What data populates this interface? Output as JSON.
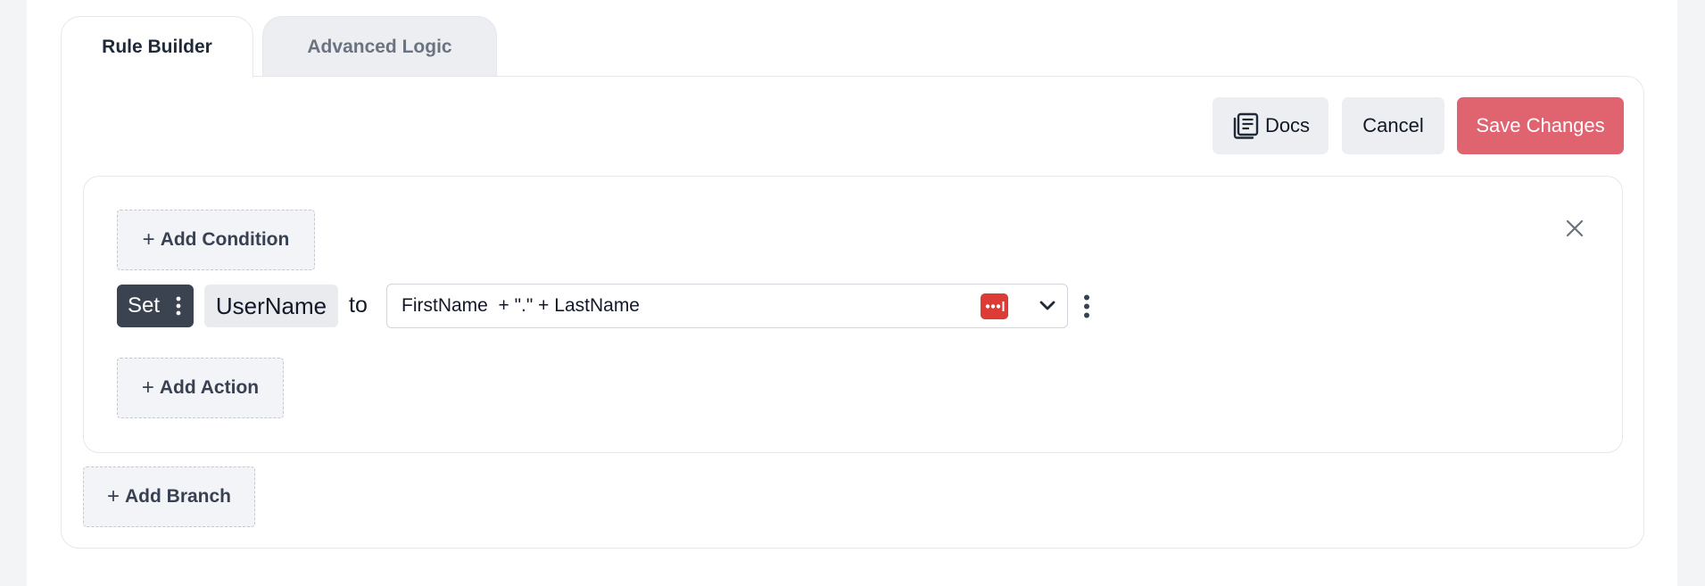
{
  "tabs": {
    "rule_builder": "Rule Builder",
    "advanced_logic": "Advanced Logic"
  },
  "toolbar": {
    "docs_label": "Docs",
    "cancel_label": "Cancel",
    "save_label": "Save Changes"
  },
  "rule": {
    "add_condition_label": "Add Condition",
    "add_action_label": "Add Action",
    "action": {
      "verb": "Set",
      "field": "UserName",
      "connector": "to",
      "expression": "FirstName  + \".\" + LastName"
    }
  },
  "add_branch_label": "Add Branch",
  "colors": {
    "save_button": "#e06370",
    "set_chip": "#3b4250",
    "expression_badge": "#dc3b36"
  },
  "icons": {
    "docs": "docs-icon",
    "plus": "plus-icon",
    "close": "close-icon",
    "kebab": "kebab-icon",
    "chevron": "chevron-down-icon",
    "expression": "expression-badge-icon"
  }
}
